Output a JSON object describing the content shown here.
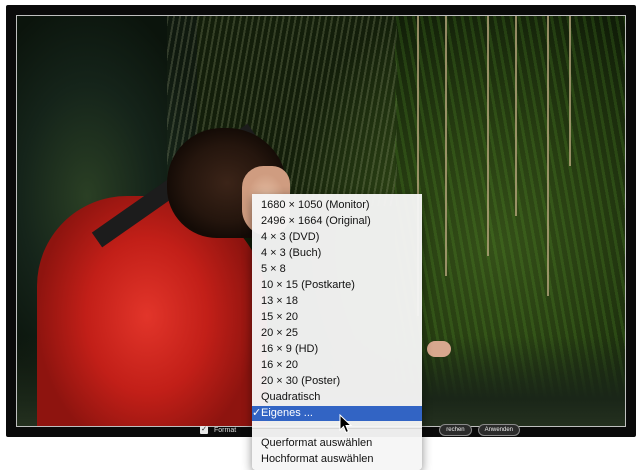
{
  "toolbar": {
    "format_label": "Format",
    "cancel_label": "rechen",
    "apply_label": "Anwenden",
    "format_checked": true
  },
  "format_menu": {
    "items": [
      "1680 × 1050  (Monitor)",
      "2496 × 1664  (Original)",
      "4 × 3  (DVD)",
      "4 × 3  (Buch)",
      "5 × 8",
      "10 × 15  (Postkarte)",
      "13 × 18",
      "15 × 20",
      "20 × 25",
      "16 × 9  (HD)",
      "16 × 20",
      "20 × 30  (Poster)",
      "Quadratisch",
      "Eigenes ..."
    ],
    "selected": "Eigenes ...",
    "orientation_items": [
      "Querformat auswählen",
      "Hochformat auswählen"
    ]
  },
  "icons": [
    "checkbox-icon",
    "checkmark-icon",
    "mouse-pointer-icon"
  ]
}
